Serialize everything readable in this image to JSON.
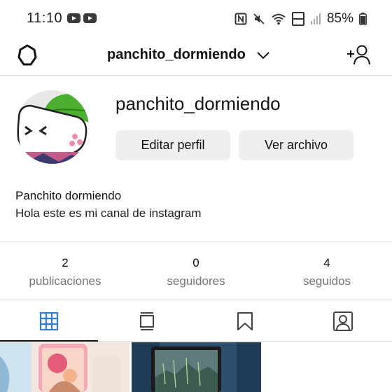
{
  "status_bar": {
    "time": "11:10",
    "battery": "85%",
    "icons": [
      "youtube-icon",
      "youtube-icon",
      "nfc-icon",
      "mute-icon",
      "wifi-icon",
      "volte-icon",
      "signal-icon",
      "battery-icon"
    ]
  },
  "header": {
    "username": "panchito_dormiendo",
    "icons": [
      "settings-icon",
      "chevron-down-icon",
      "add-user-icon"
    ]
  },
  "profile": {
    "username": "panchito_dormiendo",
    "edit_label": "Editar perfil",
    "archive_label": "Ver archivo",
    "display_name": "Panchito dormiendo",
    "bio": "Hola este es mi canal de instagram"
  },
  "stats": [
    {
      "value": "2",
      "label": "publicaciones"
    },
    {
      "value": "0",
      "label": "seguidores"
    },
    {
      "value": "4",
      "label": "seguidos"
    }
  ],
  "tabs": [
    {
      "name": "grid",
      "icon": "grid-icon",
      "active": true
    },
    {
      "name": "guides",
      "icon": "guide-icon",
      "active": false
    },
    {
      "name": "saved",
      "icon": "bookmark-icon",
      "active": false
    },
    {
      "name": "tagged",
      "icon": "tagged-user-icon",
      "active": false
    }
  ],
  "colors": {
    "active_tab": "#2a7de1",
    "button_bg": "#efefef",
    "divider": "#dbdbdb",
    "muted_text": "#757575"
  }
}
